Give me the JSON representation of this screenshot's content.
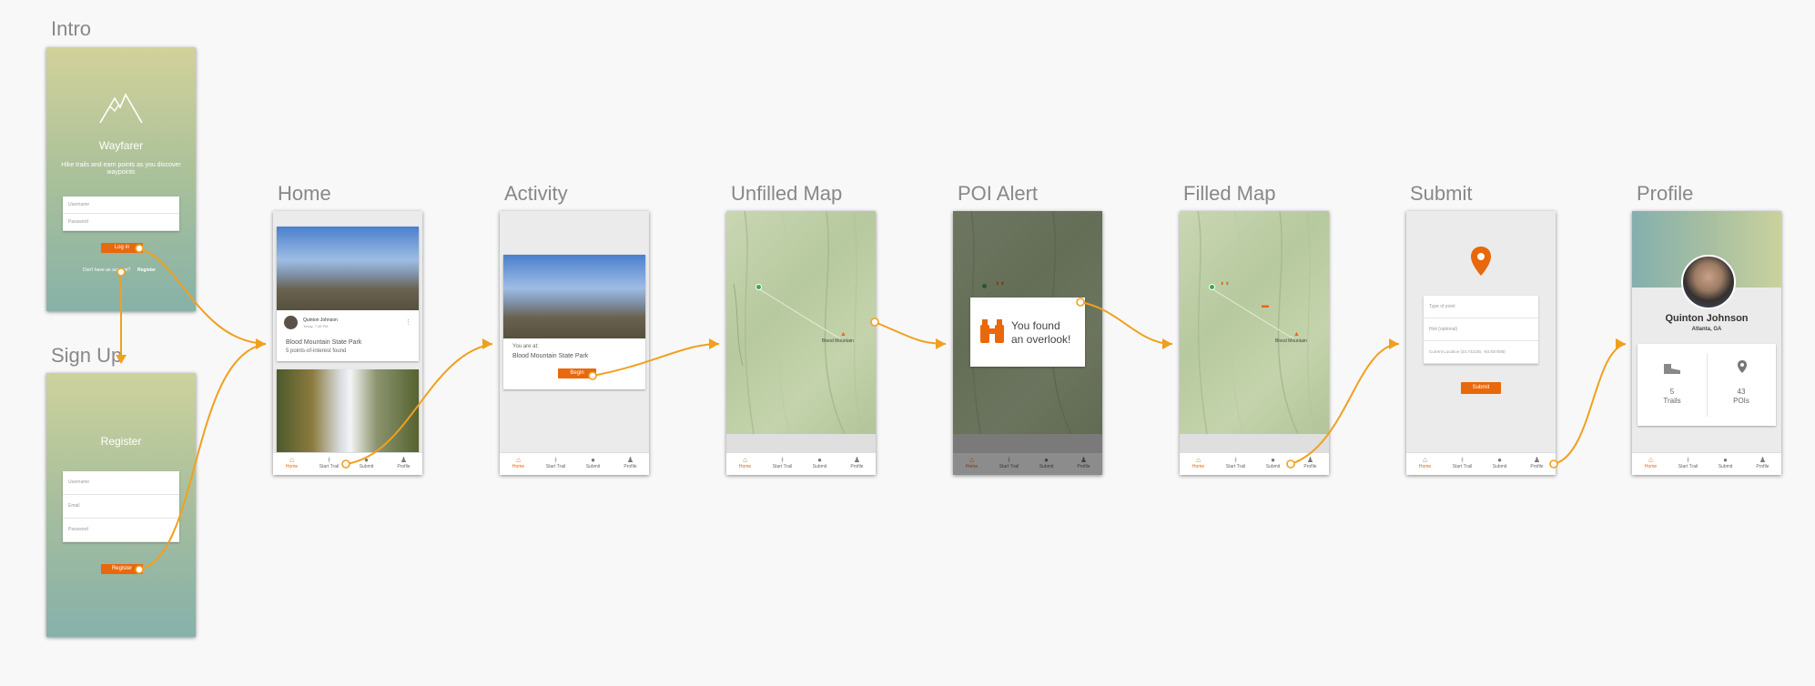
{
  "screens": {
    "intro": {
      "title": "Intro"
    },
    "signup": {
      "title": "Sign Up"
    },
    "home": {
      "title": "Home"
    },
    "activity": {
      "title": "Activity"
    },
    "unfilled_map": {
      "title": "Unfilled Map"
    },
    "poi_alert": {
      "title": "POI Alert"
    },
    "filled_map": {
      "title": "Filled Map"
    },
    "submit": {
      "title": "Submit"
    },
    "profile": {
      "title": "Profile"
    }
  },
  "intro": {
    "app_name": "Wayfarer",
    "tagline": "Hike trails and earn points as you discover waypoints",
    "username_placeholder": "Username",
    "password_placeholder": "Password",
    "login_button": "Log in",
    "no_account_text": "Don't have an account?",
    "register_link": "Register"
  },
  "signup": {
    "heading": "Register",
    "username_placeholder": "Username",
    "email_placeholder": "Email",
    "password_placeholder": "Password",
    "register_button": "Register"
  },
  "home": {
    "author": "Quinton Johnson",
    "post_meta": "Today, 7:45 PM",
    "park_name": "Blood Mountain State Park",
    "poi_count_text": "5 points-of-interest found"
  },
  "activity": {
    "you_are_at": "You are at:",
    "park_name": "Blood Mountain State Park",
    "begin_button": "Begin"
  },
  "map": {
    "peak_label": "Blood Mountain"
  },
  "poi_alert": {
    "message_line1": "You found",
    "message_line2": "an overlook!"
  },
  "submit": {
    "type_placeholder": "Type of point",
    "hint_placeholder": "Hint (optional)",
    "location_text": "Current Location (34.741180, -83.937088)",
    "submit_button": "Submit"
  },
  "profile": {
    "name": "Quinton Johnson",
    "location": "Atlanta, GA",
    "trails_count": "5",
    "trails_label": "Trails",
    "pois_count": "43",
    "pois_label": "POIs"
  },
  "tabbar": {
    "home": "Home",
    "start_trail": "Start Trail",
    "submit": "Submit",
    "profile": "Profile"
  },
  "colors": {
    "accent": "#e8680b",
    "flow_arrow": "#f0a020",
    "background": "#f8f8f8"
  }
}
